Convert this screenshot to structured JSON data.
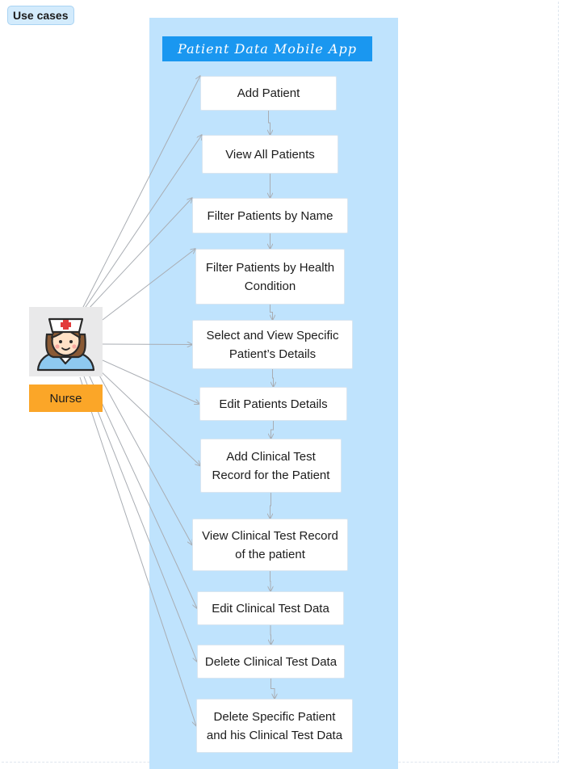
{
  "section_label": "Use cases",
  "system_title": "Patient Data Mobile App",
  "actor": {
    "label": "Nurse",
    "icon": "nurse-icon"
  },
  "use_cases": [
    {
      "id": "uc1",
      "label": "Add Patient"
    },
    {
      "id": "uc2",
      "label": "View All Patients"
    },
    {
      "id": "uc3",
      "label": "Filter Patients by Name"
    },
    {
      "id": "uc4",
      "label": "Filter Patients by Health Condition"
    },
    {
      "id": "uc5",
      "label": "Select and View Specific Patient’s Details"
    },
    {
      "id": "uc6",
      "label": "Edit Patients Details"
    },
    {
      "id": "uc7",
      "label": "Add Clinical Test Record for the Patient"
    },
    {
      "id": "uc8",
      "label": "View Clinical Test Record of the patient"
    },
    {
      "id": "uc9",
      "label": "Edit Clinical Test Data"
    },
    {
      "id": "uc10",
      "label": "Delete Clinical Test Data"
    },
    {
      "id": "uc11",
      "label": "Delete Specific Patient and his Clinical Test Data"
    }
  ],
  "colors": {
    "system_background": "#bfe3fd",
    "title_bar": "#1a97f0",
    "actor_label": "#fba628",
    "edge": "#a9adb3"
  }
}
